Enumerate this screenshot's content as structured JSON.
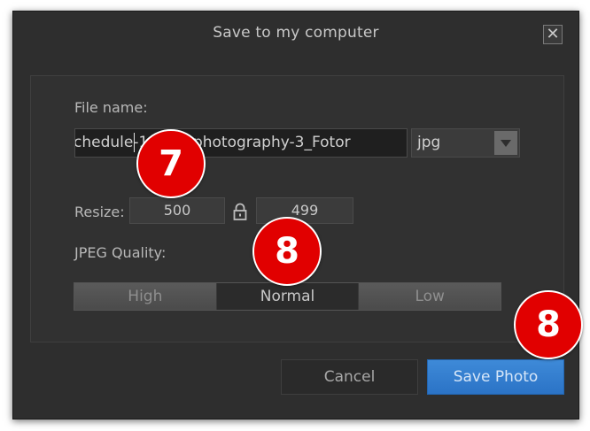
{
  "dialog": {
    "title": "Save to my computer",
    "close_symbol": "✕"
  },
  "file": {
    "label": "File name:",
    "value": "chedule-1  -bird-photography-3_Fotor",
    "extension": "jpg"
  },
  "resize": {
    "label": "Resize:",
    "width": "500",
    "height": "499",
    "lock_icon": "lock-icon"
  },
  "quality": {
    "label": "JPEG Quality:",
    "options": [
      "High",
      "Normal",
      "Low"
    ],
    "selected": "Normal"
  },
  "buttons": {
    "cancel": "Cancel",
    "save": "Save Photo"
  },
  "markers": [
    "7",
    "8",
    "8"
  ],
  "colors": {
    "dialog_bg": "#2e2e2e",
    "accent_blue": "#2b73c6",
    "marker_red": "#e10000"
  }
}
